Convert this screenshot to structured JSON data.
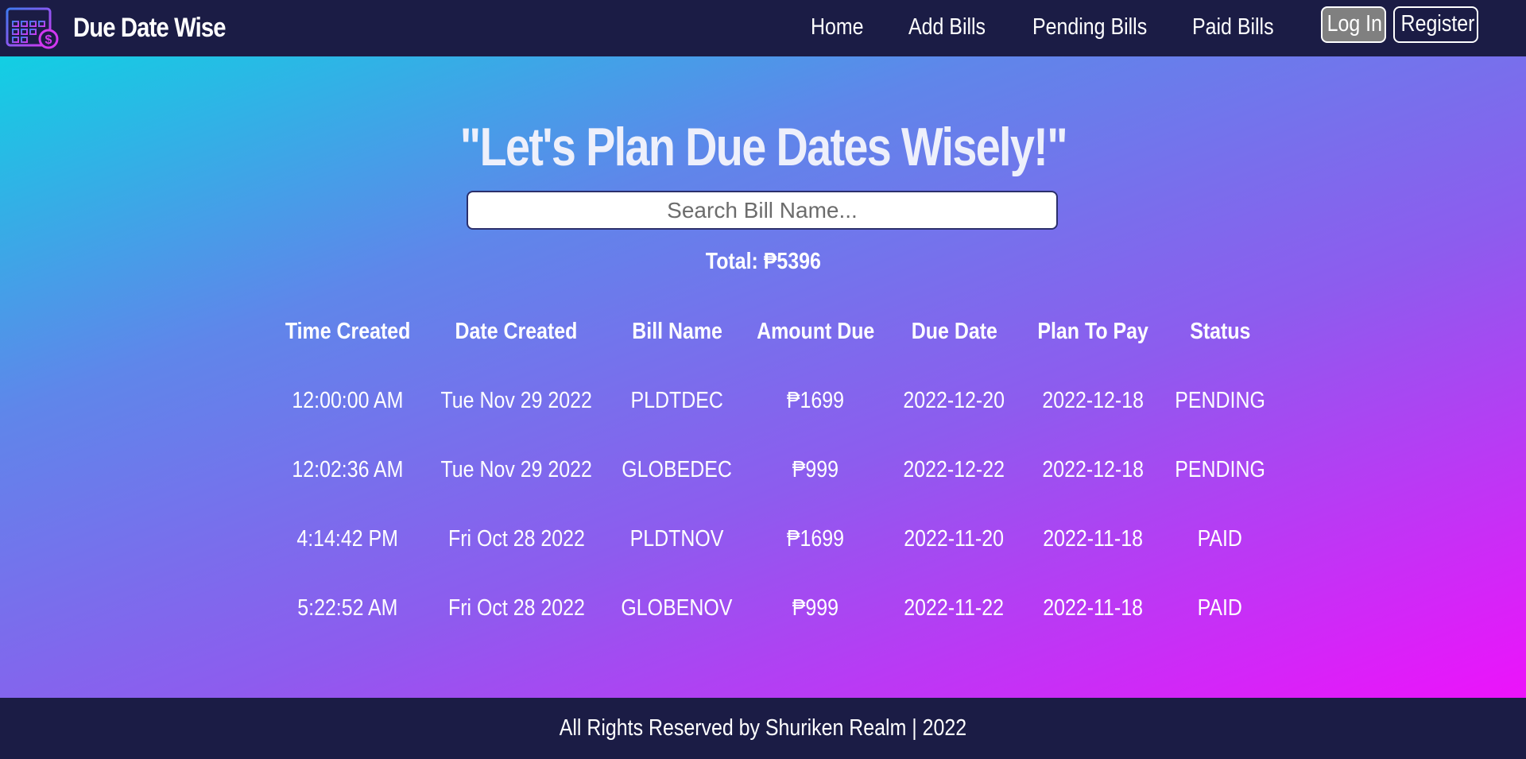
{
  "navbar": {
    "brand": "Due Date Wise",
    "logo_icon": "calendar-money-icon",
    "links": [
      "Home",
      "Add Bills",
      "Pending Bills",
      "Paid Bills"
    ],
    "login_label": "Log In",
    "register_label": "Register"
  },
  "main": {
    "headline": "\"Let's Plan Due Dates Wisely!\"",
    "search_placeholder": "Search Bill Name...",
    "total": "Total: ₱5396"
  },
  "table": {
    "headers": [
      "Time Created",
      "Date Created",
      "Bill Name",
      "Amount Due",
      "Due Date",
      "Plan To Pay",
      "Status"
    ],
    "rows": [
      [
        "12:00:00 AM",
        "Tue Nov 29 2022",
        "PLDTDEC",
        "₱1699",
        "2022-12-20",
        "2022-12-18",
        "PENDING"
      ],
      [
        "12:02:36 AM",
        "Tue Nov 29 2022",
        "GLOBEDEC",
        "₱999",
        "2022-12-22",
        "2022-12-18",
        "PENDING"
      ],
      [
        "4:14:42 PM",
        "Fri Oct 28 2022",
        "PLDTNOV",
        "₱1699",
        "2022-11-20",
        "2022-11-18",
        "PAID"
      ],
      [
        "5:22:52 AM",
        "Fri Oct 28 2022",
        "GLOBENOV",
        "₱999",
        "2022-11-22",
        "2022-11-18",
        "PAID"
      ]
    ]
  },
  "footer": {
    "text": "All Rights Reserved by Shuriken Realm | 2022"
  },
  "colors": {
    "navbar_bg": "#1b1c45",
    "gradient_start": "#12cfe3",
    "gradient_end": "#ed12fb",
    "login_bg": "#808080"
  }
}
